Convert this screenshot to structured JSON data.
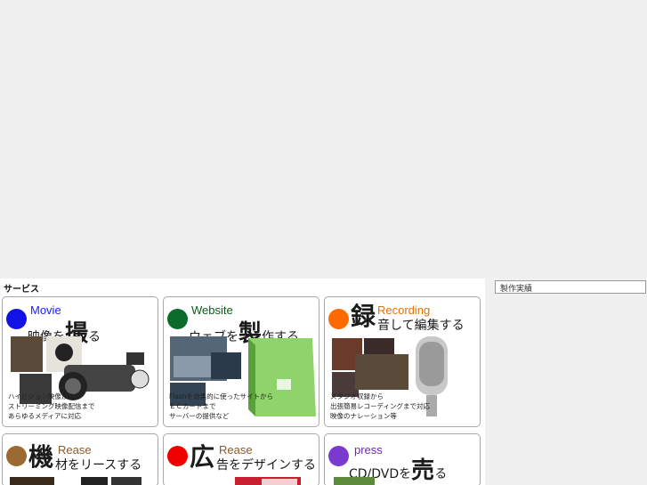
{
  "section": {
    "title": "サービス"
  },
  "sidebar": {
    "box_label": "製作実績"
  },
  "cards": [
    {
      "en": "Movie",
      "en_color": "#1a1aff",
      "jp": "映像を",
      "big": "撮",
      "jp_tail": "る",
      "dot_color": "#1212e6",
      "desc": "ハイビジョン映像から\nストリーミング映像配信まで\nあらゆるメディアに対応"
    },
    {
      "en": "Website",
      "en_color": "#0c5a1a",
      "jp": "ウェブを",
      "big": "製",
      "jp_tail": "作する",
      "dot_color": "#0b6b2a",
      "desc": "Flashを効果的に使ったサイトから\nＥＣカートまで\nサーバーの提供など"
    },
    {
      "en": "Recording",
      "en_color": "#e87000",
      "jp": "音して編集する",
      "big": "録",
      "jp_tail": "",
      "dot_color": "#ff6a00",
      "desc": "スタジオ収録から\n出張簡易レコーディングまで対応\n映像のナレーション等"
    },
    {
      "en": "Rease",
      "en_color": "#8a5a2a",
      "jp": "材をリースする",
      "big": "機",
      "jp_tail": "",
      "dot_color": "#9a6a32",
      "desc": ""
    },
    {
      "en": "Rease",
      "en_color": "#8a5a2a",
      "jp": "告をデザインする",
      "big": "広",
      "jp_tail": "",
      "dot_color": "#ee0000",
      "desc": ""
    },
    {
      "en": "press",
      "en_color": "#6a2ab0",
      "jp": "CD/DVDを",
      "big": "売",
      "jp_tail": "る",
      "dot_color": "#7a3ad0",
      "desc": ""
    }
  ]
}
